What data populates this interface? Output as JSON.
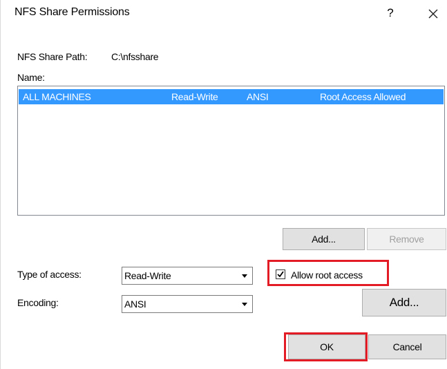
{
  "window": {
    "title": "NFS Share Permissions",
    "help_glyph": "?",
    "close_icon": "close-icon"
  },
  "share_path": {
    "label": "NFS Share Path:",
    "value": "C:\\nfsshare"
  },
  "name_list": {
    "label": "Name:",
    "rows": [
      {
        "name": "ALL MACHINES",
        "access": "Read-Write",
        "encoding": "ANSI",
        "root": "Root Access Allowed",
        "selected": true
      }
    ]
  },
  "list_buttons": {
    "add": "Add...",
    "remove": "Remove"
  },
  "type_of_access": {
    "label": "Type of access:",
    "value": "Read-Write"
  },
  "encoding": {
    "label": "Encoding:",
    "value": "ANSI"
  },
  "allow_root_access": {
    "label": "Allow root access",
    "checked": true
  },
  "add2_label": "Add...",
  "ok_label": "OK",
  "cancel_label": "Cancel",
  "colors": {
    "selection": "#3399ff",
    "highlight_box": "#e21b24"
  }
}
